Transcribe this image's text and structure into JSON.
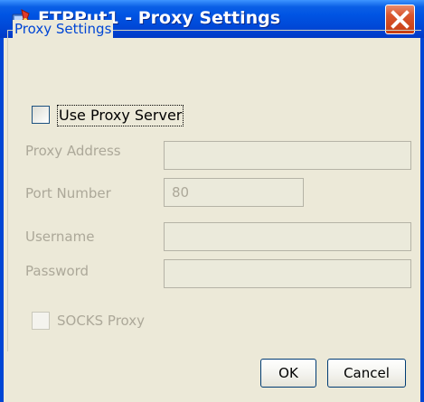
{
  "window": {
    "title": "FTPPut1 - Proxy Settings",
    "title_bar_color": "#0054e3",
    "close_button_color": "#d9562e",
    "app_icon": "ftpput-app-icon",
    "close_icon": "close-x-icon"
  },
  "group": {
    "legend": "Proxy Settings",
    "legend_color": "#0046d5"
  },
  "use_proxy": {
    "label": "Use Proxy Server",
    "checked": false
  },
  "fields": {
    "proxy_address": {
      "label": "Proxy Address",
      "value": ""
    },
    "port_number": {
      "label": "Port Number",
      "value": "80"
    },
    "username": {
      "label": "Username",
      "value": ""
    },
    "password": {
      "label": "Password",
      "value": ""
    }
  },
  "socks": {
    "label": "SOCKS Proxy",
    "checked": false,
    "enabled": false
  },
  "buttons": {
    "ok": "OK",
    "cancel": "Cancel"
  },
  "colors": {
    "disabled_text": "#aca899",
    "disabled_field_bg": "#ebeadb",
    "dialog_bg": "#ece9d8"
  }
}
